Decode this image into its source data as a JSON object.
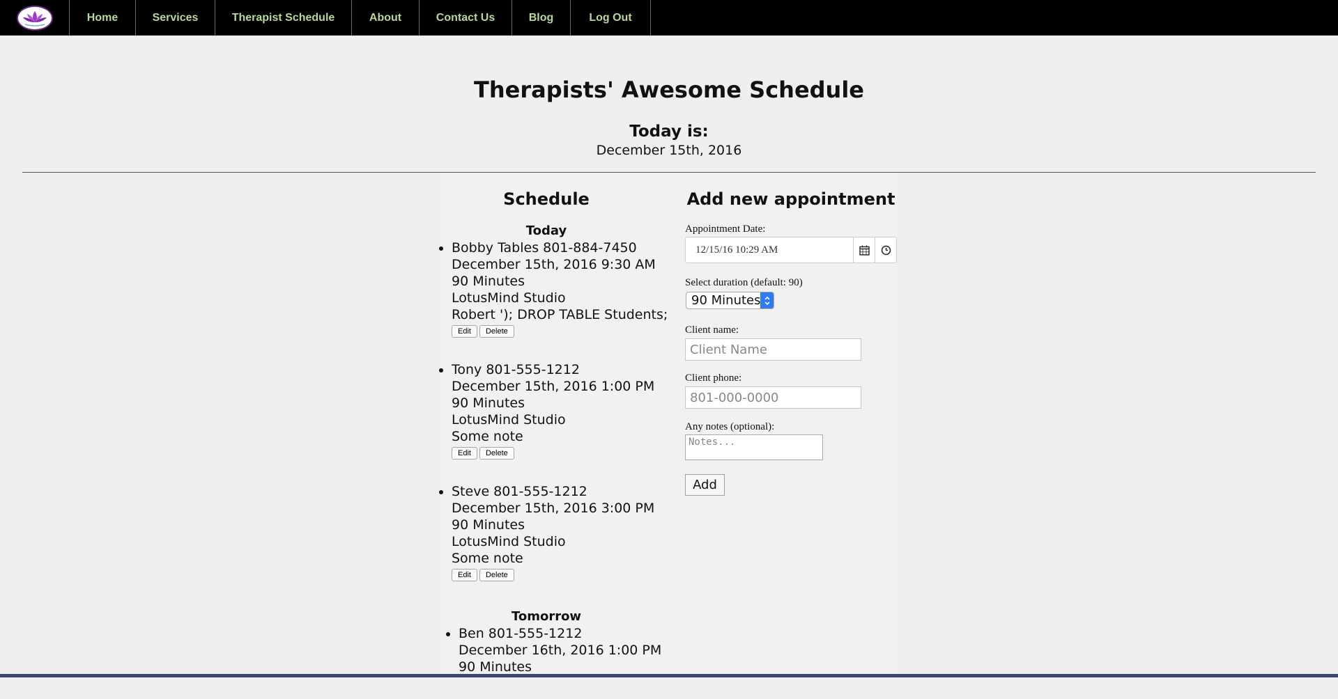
{
  "nav": {
    "logo_icon": "lotus-icon",
    "items": [
      "Home",
      "Services",
      "Therapist Schedule",
      "About",
      "Contact Us",
      "Blog",
      "Log Out"
    ]
  },
  "header": {
    "title": "Therapists' Awesome Schedule",
    "today_label": "Today is:",
    "today_date": "December 15th, 2016"
  },
  "schedule": {
    "title": "Schedule",
    "today": {
      "label": "Today",
      "appointments": [
        {
          "client": "Bobby Tables 801-884-7450",
          "datetime": "December 15th, 2016 9:30 AM",
          "duration": "90 Minutes",
          "location": "LotusMind Studio",
          "note": "Robert '); DROP TABLE Students;"
        },
        {
          "client": "Tony 801-555-1212",
          "datetime": "December 15th, 2016 1:00 PM",
          "duration": "90 Minutes",
          "location": "LotusMind Studio",
          "note": "Some note"
        },
        {
          "client": "Steve 801-555-1212",
          "datetime": "December 15th, 2016 3:00 PM",
          "duration": "90 Minutes",
          "location": "LotusMind Studio",
          "note": "Some note"
        }
      ]
    },
    "tomorrow": {
      "label": "Tomorrow",
      "appointments": [
        {
          "client": "Ben 801-555-1212",
          "datetime": "December 16th, 2016 1:00 PM",
          "duration": "90 Minutes"
        }
      ]
    },
    "edit_label": "Edit",
    "delete_label": "Delete"
  },
  "form": {
    "title": "Add new appointment",
    "date_label": "Appointment Date:",
    "date_value": "12/15/16 10:29 AM",
    "calendar_icon": "calendar-icon",
    "clock_icon": "clock-icon",
    "duration_label": "Select duration (default: 90)",
    "duration_value": "90 Minutes",
    "client_name_label": "Client name:",
    "client_name_placeholder": "Client Name",
    "client_phone_label": "Client phone:",
    "client_phone_placeholder": "801-000-0000",
    "notes_label": "Any notes (optional):",
    "notes_placeholder": "Notes...",
    "add_label": "Add"
  },
  "colors": {
    "nav_bg": "#000000",
    "nav_text": "#b8d89a",
    "page_bg": "#efefef",
    "select_accent": "#2f7bf0"
  }
}
